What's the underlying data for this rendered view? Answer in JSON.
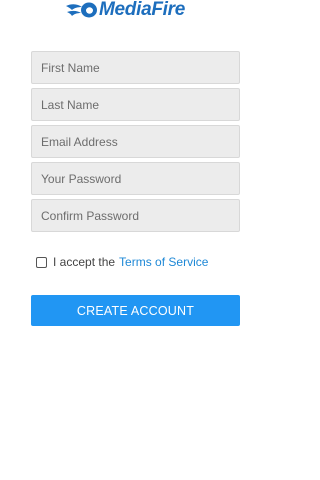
{
  "header": {
    "logo_text": "MediaFire",
    "brand_color": "#1d6ebd",
    "logo_icon": "mediafire-flame-icon"
  },
  "form": {
    "first_name": {
      "placeholder": "First Name",
      "value": ""
    },
    "last_name": {
      "placeholder": "Last Name",
      "value": ""
    },
    "email": {
      "placeholder": "Email Address",
      "value": ""
    },
    "password": {
      "placeholder": "Your Password",
      "value": ""
    },
    "confirm_password": {
      "placeholder": "Confirm Password",
      "value": ""
    }
  },
  "terms": {
    "checked": false,
    "prefix": "I accept the",
    "link_text": "Terms of Service",
    "link_color": "#1e88d6"
  },
  "create_button": {
    "label": "CREATE ACCOUNT",
    "color": "#2196f3"
  }
}
